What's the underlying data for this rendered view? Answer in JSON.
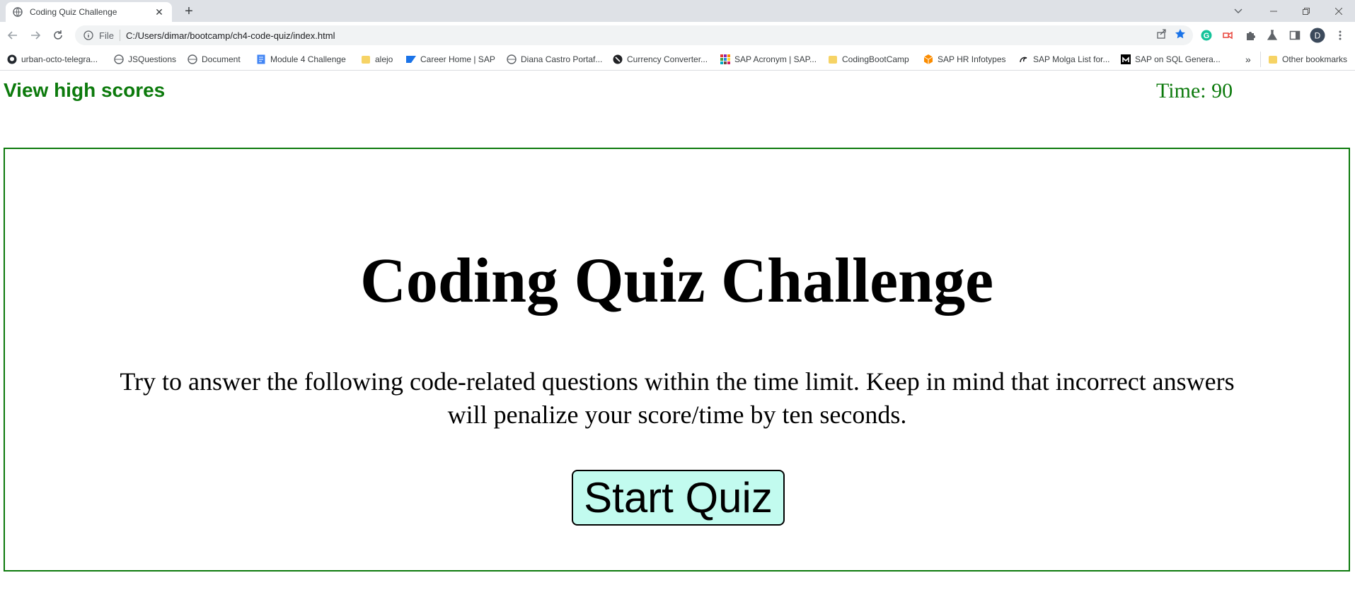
{
  "browser": {
    "tab": {
      "title": "Coding Quiz Challenge",
      "close_icon": "close-icon",
      "favicon": "globe-icon"
    },
    "new_tab_icon": "plus-icon",
    "window_controls": [
      "chevron-down-icon",
      "minimize-icon",
      "restore-icon",
      "close-icon"
    ],
    "address": {
      "scheme_label": "File",
      "url": "C:/Users/dimar/bootcamp/ch4-code-quiz/index.html"
    },
    "profile_initial": "D",
    "bookmarks": [
      "urban-octo-telegra...",
      "JSQuestions",
      "Document",
      "Module 4 Challenge",
      "alejo",
      "Career Home | SAP",
      "Diana Castro Portaf...",
      "Currency Converter...",
      "SAP Acronym | SAP...",
      "CodingBootCamp",
      "SAP HR Infotypes",
      "SAP Molga List for...",
      "SAP on SQL Genera..."
    ],
    "more_bookmarks": "»",
    "other_bookmarks": "Other bookmarks"
  },
  "page": {
    "highscores_link": "View high scores",
    "timer": "Time: 90",
    "quiz": {
      "title": "Coding Quiz Challenge",
      "description": "Try to answer the following code-related questions within the time limit. Keep in mind that incorrect answers will penalize your score/time by ten seconds.",
      "start_button": "Start Quiz"
    }
  },
  "colors": {
    "accent_green": "#0c7a0c",
    "button_bg": "#c2fbef"
  }
}
